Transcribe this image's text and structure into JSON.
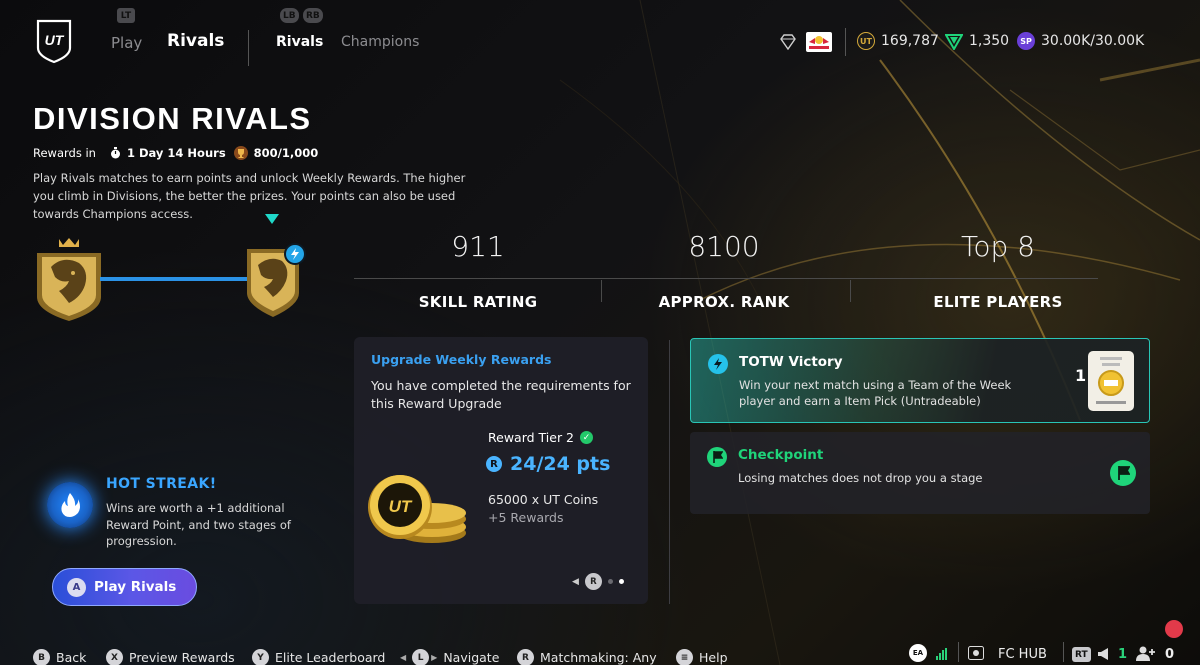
{
  "nav": {
    "lt_hint": "LT",
    "lb_hint": "LB",
    "rb_hint": "RB",
    "play": "Play",
    "rivals": "Rivals",
    "sub_rivals": "Rivals",
    "sub_champions": "Champions"
  },
  "currencies": {
    "coins": "169,787",
    "points": "1,350",
    "sp": "30.00K/30.00K",
    "sp_icon_label": "SP"
  },
  "header": {
    "title": "DIVISION RIVALS",
    "rewards_in_label": "Rewards in",
    "rewards_time": "1 Day 14 Hours",
    "rewards_progress": "800/1,000",
    "description": "Play Rivals matches to earn points and unlock Weekly Rewards. The higher you climb in Divisions, the better the prizes. Your points can also be used towards Champions access."
  },
  "stats": [
    {
      "value": "911",
      "label": "SKILL RATING"
    },
    {
      "value": "8100",
      "label": "APPROX. RANK"
    },
    {
      "value": "Top 8",
      "label": "ELITE PLAYERS"
    }
  ],
  "upgrade": {
    "title": "Upgrade Weekly Rewards",
    "text": "You have completed the requirements for this Reward Upgrade",
    "tier": "Reward Tier 2",
    "pts": "24/24 pts",
    "coins": "65000 x UT Coins",
    "more": "+5 Rewards",
    "pager_btn": "R"
  },
  "objectives": {
    "totw": {
      "title": "TOTW Victory",
      "text": "Win your next match using a Team of the Week player and earn a Item Pick (Untradeable)",
      "count": "1"
    },
    "checkpoint": {
      "title": "Checkpoint",
      "text": "Losing matches does not drop you a stage"
    }
  },
  "hot_streak": {
    "title": "HOT STREAK!",
    "text": "Wins are worth a +1 additional Reward Point, and two stages of progression."
  },
  "play_button": {
    "key": "A",
    "label": "Play Rivals"
  },
  "footer": {
    "back": {
      "key": "B",
      "label": "Back"
    },
    "preview": {
      "key": "X",
      "label": "Preview Rewards"
    },
    "leaderboard": {
      "key": "Y",
      "label": "Elite Leaderboard"
    },
    "navigate": {
      "key": "L",
      "label": "Navigate"
    },
    "matchmaking": {
      "key": "R",
      "label": "Matchmaking: Any"
    },
    "help": {
      "key": "≡",
      "label": "Help"
    },
    "ea_label": "EA",
    "fc_hub": "FC HUB",
    "rt_hint": "RT",
    "friends_count": "1",
    "users_count": "0"
  },
  "colors": {
    "accent_blue": "#3aa0f0",
    "teal": "#29c5b6",
    "green": "#1fd47a",
    "gold": "#d4a93a"
  }
}
